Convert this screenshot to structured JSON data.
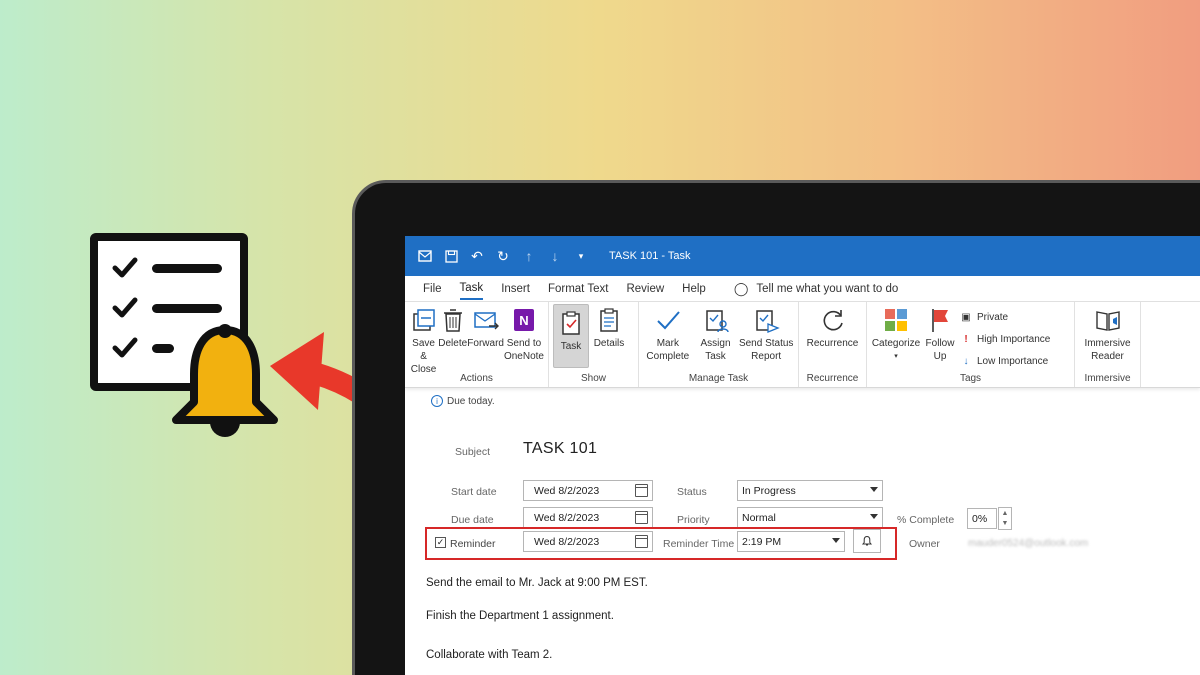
{
  "window": {
    "title": "TASK 101 - Task"
  },
  "menu": {
    "tabs": [
      "File",
      "Task",
      "Insert",
      "Format Text",
      "Review",
      "Help"
    ],
    "active_tab": "Task",
    "tell_me": "Tell me what you want to do"
  },
  "ribbon": {
    "actions": {
      "label": "Actions",
      "save_close": "Save & Close",
      "delete": "Delete",
      "forward": "Forward",
      "send_onenote": "Send to OneNote"
    },
    "show": {
      "label": "Show",
      "task": "Task",
      "details": "Details"
    },
    "manage_task": {
      "label": "Manage Task",
      "mark_complete": "Mark Complete",
      "assign_task": "Assign Task",
      "send_status_report": "Send Status Report"
    },
    "recurrence": {
      "label": "Recurrence",
      "recurrence": "Recurrence"
    },
    "tags": {
      "label": "Tags",
      "categorize": "Categorize",
      "follow_up": "Follow Up",
      "private": "Private",
      "high_importance": "High Importance",
      "low_importance": "Low Importance"
    },
    "immersive": {
      "label": "Immersive",
      "immersive_reader": "Immersive Reader"
    }
  },
  "info": {
    "message": "Due today."
  },
  "form": {
    "subject_label": "Subject",
    "subject_value": "TASK 101",
    "start_date_label": "Start date",
    "start_date_value": "Wed 8/2/2023",
    "due_date_label": "Due date",
    "due_date_value": "Wed 8/2/2023",
    "reminder_label": "Reminder",
    "reminder_checked": true,
    "reminder_date_value": "Wed 8/2/2023",
    "status_label": "Status",
    "status_value": "In Progress",
    "priority_label": "Priority",
    "priority_value": "Normal",
    "reminder_time_label": "Reminder Time",
    "reminder_time_value": "2:19 PM",
    "percent_label": "% Complete",
    "percent_value": "0%",
    "owner_label": "Owner",
    "owner_value": "mauder0524@outlook.com"
  },
  "body": {
    "lines": [
      "Send the email to Mr. Jack at 9:00 PM EST.",
      "Finish the Department 1 assignment.",
      "Collaborate with Team 2."
    ]
  },
  "colors": {
    "titlebar": "#1f6fc4",
    "highlight": "#d62828",
    "arrow": "#e8382a",
    "bell": "#f2b10f"
  }
}
